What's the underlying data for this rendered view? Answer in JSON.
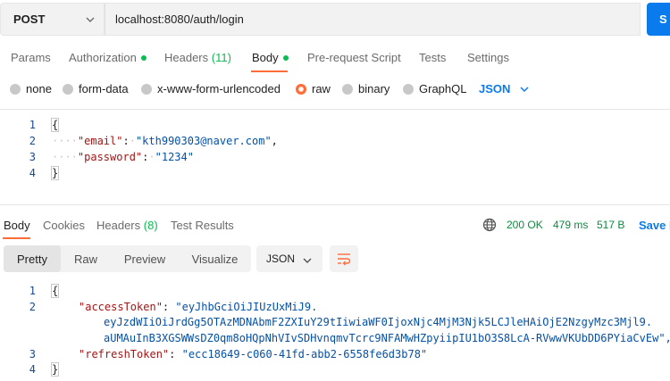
{
  "request": {
    "method": "POST",
    "url": "localhost:8080/auth/login",
    "send_label": "S"
  },
  "request_tabs": {
    "params": "Params",
    "authorization": "Authorization",
    "headers": "Headers",
    "headers_count": "(11)",
    "body": "Body",
    "pre_request": "Pre-request Script",
    "tests": "Tests",
    "settings": "Settings"
  },
  "body_types": {
    "none": "none",
    "form_data": "form-data",
    "urlencoded": "x-www-form-urlencoded",
    "raw": "raw",
    "binary": "binary",
    "graphql": "GraphQL",
    "selected": "raw",
    "language": "JSON"
  },
  "request_body": {
    "line_numbers": [
      "1",
      "2",
      "3",
      "4"
    ],
    "open_brace": "{",
    "close_brace": "}",
    "email_key": "\"email\"",
    "email_value": "\"kth990303@naver.com\"",
    "password_key": "\"password\"",
    "password_value": "\"1234\""
  },
  "response_tabs": {
    "body": "Body",
    "cookies": "Cookies",
    "headers": "Headers",
    "headers_count": "(8)",
    "test_results": "Test Results"
  },
  "response_status": {
    "status": "200 OK",
    "time": "479 ms",
    "size": "517 B",
    "save_label": "Save R"
  },
  "response_view": {
    "pretty": "Pretty",
    "raw": "Raw",
    "preview": "Preview",
    "visualize": "Visualize",
    "format": "JSON"
  },
  "response_body": {
    "line_numbers": [
      "1",
      "2",
      "3",
      "4"
    ],
    "open_brace": "{",
    "close_brace": "}",
    "access_key": "\"accessToken\"",
    "access_line1": "\"eyJhbGciOiJIUzUxMiJ9.",
    "access_line2": "eyJzdWIiOiJrdGg5OTAzMDNAbmF2ZXIuY29tIiwiaWF0IjoxNjc4MjM3Njk5LCJleHAiOjE2NzgyMzc3Mjl9.",
    "access_line3": "aUMAuInB3XGSWWsDZ0qm8oHQpNhVIvSDHvnqmvTcrc9NFAMwHZpyiipIU1bO3S8LcA-RVwwVKUbDD6PYiaCvEw\",",
    "refresh_key": "\"refreshToken\"",
    "refresh_value": "\"ecc18649-c060-41fd-abb2-6558fe6d3b78\""
  },
  "icons": {
    "method_chevron": "chevron-down-icon",
    "language_chevron": "chevron-down-icon",
    "globe": "globe-icon",
    "wrap": "wrap-lines-icon"
  },
  "colors": {
    "accent_orange": "#ff6c37",
    "link_blue": "#097bed",
    "status_green": "#0cbb52"
  }
}
